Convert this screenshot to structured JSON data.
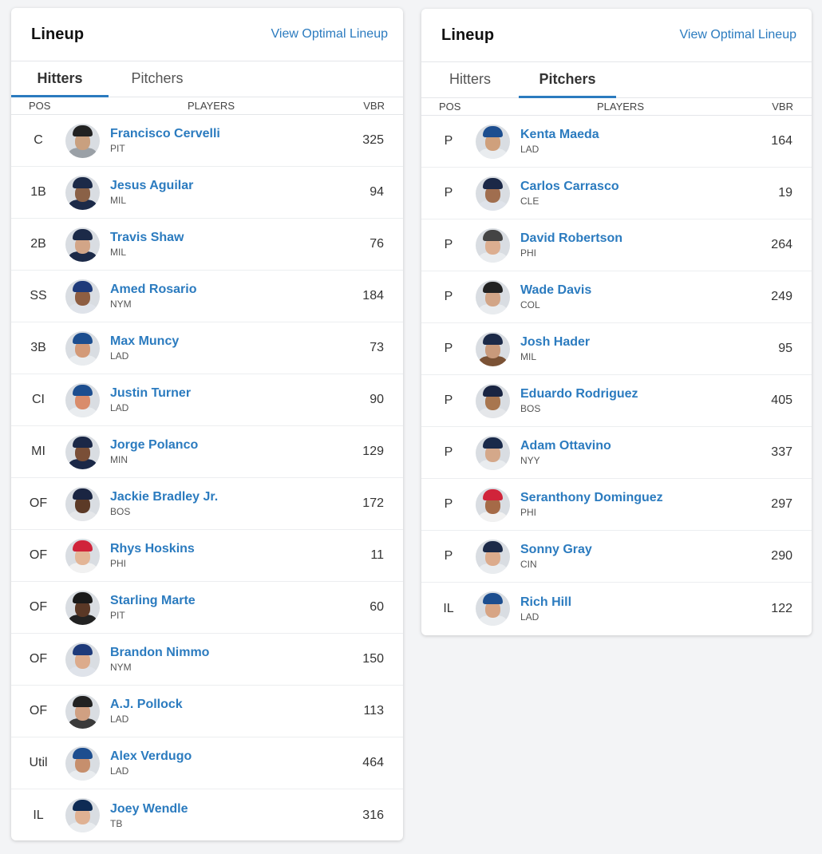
{
  "hitters_card": {
    "title": "Lineup",
    "link": "View Optimal Lineup",
    "tabs": [
      {
        "label": "Hitters",
        "active": true
      },
      {
        "label": "Pitchers",
        "active": false
      }
    ],
    "columns": {
      "pos": "POS",
      "players": "PLAYERS",
      "vbr": "VBR"
    },
    "rows": [
      {
        "pos": "C",
        "name": "Francisco Cervelli",
        "team": "PIT",
        "vbr": "325",
        "cap": "#222222",
        "skin": "#c9a07f",
        "shirt": "#9aa0a6"
      },
      {
        "pos": "1B",
        "name": "Jesus Aguilar",
        "team": "MIL",
        "vbr": "94",
        "cap": "#1c2a48",
        "skin": "#8a6147",
        "shirt": "#1c2a48"
      },
      {
        "pos": "2B",
        "name": "Travis Shaw",
        "team": "MIL",
        "vbr": "76",
        "cap": "#1c2a48",
        "skin": "#d2a587",
        "shirt": "#1c2a48"
      },
      {
        "pos": "SS",
        "name": "Amed Rosario",
        "team": "NYM",
        "vbr": "184",
        "cap": "#1e3a7a",
        "skin": "#8e5e42",
        "shirt": "#dfe3ea"
      },
      {
        "pos": "3B",
        "name": "Max Muncy",
        "team": "LAD",
        "vbr": "73",
        "cap": "#1d4e8f",
        "skin": "#d39a78",
        "shirt": "#e9ecef"
      },
      {
        "pos": "CI",
        "name": "Justin Turner",
        "team": "LAD",
        "vbr": "90",
        "cap": "#1d4e8f",
        "skin": "#d98c6b",
        "shirt": "#e9ecef"
      },
      {
        "pos": "MI",
        "name": "Jorge Polanco",
        "team": "MIN",
        "vbr": "129",
        "cap": "#1b2847",
        "skin": "#7a4f37",
        "shirt": "#1b2847"
      },
      {
        "pos": "OF",
        "name": "Jackie Bradley Jr.",
        "team": "BOS",
        "vbr": "172",
        "cap": "#1a2542",
        "skin": "#5c3a27",
        "shirt": "#e5e7ea"
      },
      {
        "pos": "OF",
        "name": "Rhys Hoskins",
        "team": "PHI",
        "vbr": "11",
        "cap": "#d0243a",
        "skin": "#e3b596",
        "shirt": "#f1f1f1"
      },
      {
        "pos": "OF",
        "name": "Starling Marte",
        "team": "PIT",
        "vbr": "60",
        "cap": "#1a1a1a",
        "skin": "#5a3826",
        "shirt": "#222222"
      },
      {
        "pos": "OF",
        "name": "Brandon Nimmo",
        "team": "NYM",
        "vbr": "150",
        "cap": "#1e3a7a",
        "skin": "#dcab8c",
        "shirt": "#dfe3ea"
      },
      {
        "pos": "OF",
        "name": "A.J. Pollock",
        "team": "LAD",
        "vbr": "113",
        "cap": "#222222",
        "skin": "#d0a082",
        "shirt": "#3a3a3a"
      },
      {
        "pos": "Util",
        "name": "Alex Verdugo",
        "team": "LAD",
        "vbr": "464",
        "cap": "#1d4e8f",
        "skin": "#c68f6d",
        "shirt": "#e9ecef"
      },
      {
        "pos": "IL",
        "name": "Joey Wendle",
        "team": "TB",
        "vbr": "316",
        "cap": "#0e2b54",
        "skin": "#dfb193",
        "shirt": "#e9ecef"
      }
    ]
  },
  "pitchers_card": {
    "title": "Lineup",
    "link": "View Optimal Lineup",
    "tabs": [
      {
        "label": "Hitters",
        "active": false
      },
      {
        "label": "Pitchers",
        "active": true
      }
    ],
    "columns": {
      "pos": "POS",
      "players": "PLAYERS",
      "vbr": "VBR"
    },
    "rows": [
      {
        "pos": "P",
        "name": "Kenta Maeda",
        "team": "LAD",
        "vbr": "164",
        "cap": "#1d4e8f",
        "skin": "#cfa07c",
        "shirt": "#e9ecef"
      },
      {
        "pos": "P",
        "name": "Carlos Carrasco",
        "team": "CLE",
        "vbr": "19",
        "cap": "#1b2847",
        "skin": "#a06e4f",
        "shirt": "#dfe3ea"
      },
      {
        "pos": "P",
        "name": "David Robertson",
        "team": "PHI",
        "vbr": "264",
        "cap": "#444444",
        "skin": "#dcae90",
        "shirt": "#e9ecef"
      },
      {
        "pos": "P",
        "name": "Wade Davis",
        "team": "COL",
        "vbr": "249",
        "cap": "#222222",
        "skin": "#d2a587",
        "shirt": "#e9ecef"
      },
      {
        "pos": "P",
        "name": "Josh Hader",
        "team": "MIL",
        "vbr": "95",
        "cap": "#1c2a48",
        "skin": "#c99a7b",
        "shirt": "#7b5235"
      },
      {
        "pos": "P",
        "name": "Eduardo Rodriguez",
        "team": "BOS",
        "vbr": "405",
        "cap": "#1a2542",
        "skin": "#a8764f",
        "shirt": "#e5e7ea"
      },
      {
        "pos": "P",
        "name": "Adam Ottavino",
        "team": "NYY",
        "vbr": "337",
        "cap": "#1a2a4a",
        "skin": "#d4a88a",
        "shirt": "#e9ecef"
      },
      {
        "pos": "P",
        "name": "Seranthony Dominguez",
        "team": "PHI",
        "vbr": "297",
        "cap": "#d0243a",
        "skin": "#a56a47",
        "shirt": "#f1f1f1"
      },
      {
        "pos": "P",
        "name": "Sonny Gray",
        "team": "CIN",
        "vbr": "290",
        "cap": "#1c2a48",
        "skin": "#dcab8c",
        "shirt": "#e9ecef"
      },
      {
        "pos": "IL",
        "name": "Rich Hill",
        "team": "LAD",
        "vbr": "122",
        "cap": "#1d4e8f",
        "skin": "#d7a585",
        "shirt": "#e9ecef"
      }
    ]
  }
}
